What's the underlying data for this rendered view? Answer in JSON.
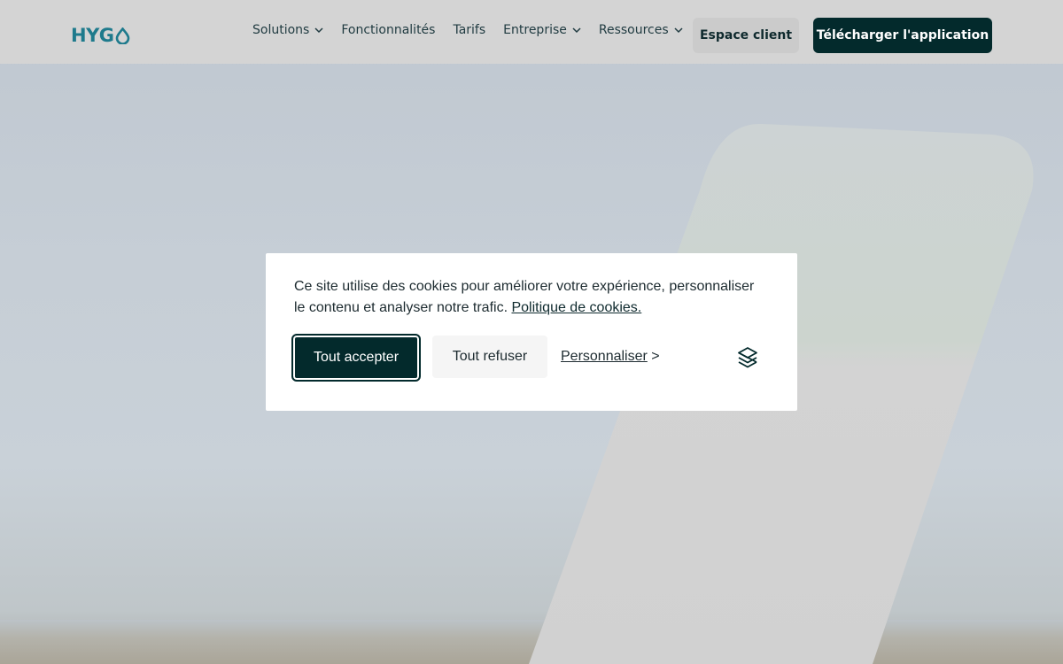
{
  "brand": {
    "logo_text": "HYG",
    "accent": "#1e7a8c",
    "dark": "#032a2c"
  },
  "nav": {
    "items": [
      {
        "label": "Solutions",
        "has_dropdown": true
      },
      {
        "label": "Fonctionnalités",
        "has_dropdown": false
      },
      {
        "label": "Tarifs",
        "has_dropdown": false
      },
      {
        "label": "Entreprise",
        "has_dropdown": true
      },
      {
        "label": "Ressources",
        "has_dropdown": true
      }
    ],
    "client_label": "Espace client",
    "download_label": "Télécharger l'application"
  },
  "cookie": {
    "message": "Ce site utilise des cookies pour améliorer votre expérience, personnaliser le contenu et analyser notre trafic.",
    "policy_link": "Politique de cookies.",
    "accept_label": "Tout accepter",
    "refuse_label": "Tout refuser",
    "personalize_label": "Personnaliser",
    "personalize_arrow": ">",
    "provider_icon": "stacked-layers-icon"
  }
}
